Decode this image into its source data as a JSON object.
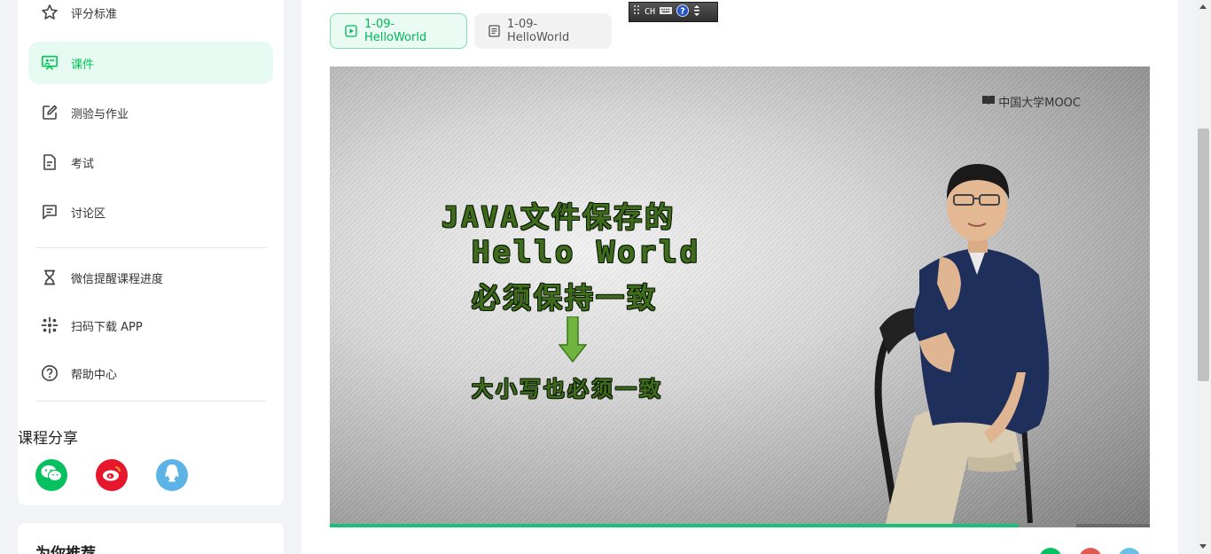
{
  "sidebar": {
    "items": [
      {
        "label": "评分标准",
        "icon": "star-icon"
      },
      {
        "label": "课件",
        "icon": "presentation-icon",
        "active": true
      },
      {
        "label": "测验与作业",
        "icon": "edit-icon"
      },
      {
        "label": "考试",
        "icon": "document-icon"
      },
      {
        "label": "讨论区",
        "icon": "comment-icon"
      }
    ],
    "extra_items": [
      {
        "label": "微信提醒课程进度",
        "icon": "hourglass-icon"
      },
      {
        "label": "扫码下载 APP",
        "icon": "qr-code-icon"
      },
      {
        "label": "帮助中心",
        "icon": "help-icon"
      }
    ],
    "share_title": "课程分享",
    "share": [
      {
        "icon": "wechat-icon",
        "color": "#07c160"
      },
      {
        "icon": "weibo-icon",
        "color": "#e6162d"
      },
      {
        "icon": "qq-icon",
        "color": "#5db3e6"
      }
    ],
    "recommend_title": "为你推荐"
  },
  "main": {
    "tabs": [
      {
        "label": "1-09-HelloWorld",
        "icon": "video-icon",
        "active": true
      },
      {
        "label": "1-09-HelloWorld",
        "icon": "doc-icon",
        "active": false
      }
    ],
    "ime": {
      "mode": "CH"
    },
    "video": {
      "watermark": "中国大学MOOC",
      "lines": [
        "JAVA文件保存的",
        "Hello World",
        "必须保持一致",
        "大小写也必须一致"
      ],
      "progress": 0.84,
      "buffered": 0.91
    }
  },
  "colors": {
    "accent": "#00c758",
    "active_bg": "#e6faf1"
  }
}
